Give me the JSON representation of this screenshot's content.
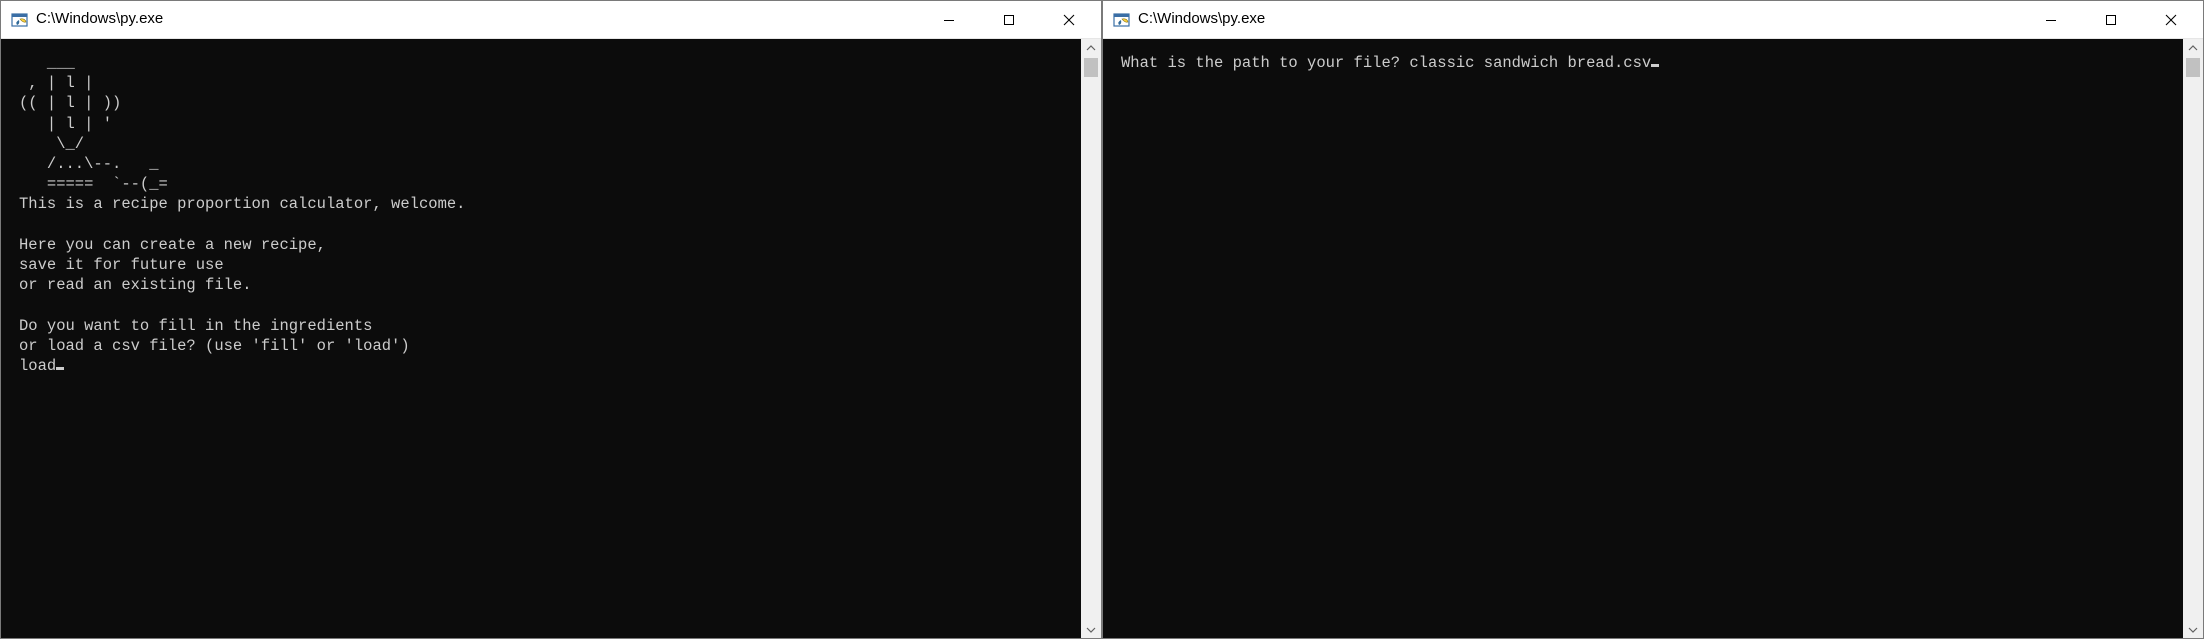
{
  "left_window": {
    "title": "C:\\Windows\\py.exe",
    "ascii_art": "   ___\n , | l |\n(( | l | ))\n   | l | '\n    \\_/\n   /...\\--.   _\n   =====  `--(_=",
    "lines": [
      "This is a recipe proportion calculator, welcome.",
      "",
      "Here you can create a new recipe,",
      "save it for future use",
      "or read an existing file.",
      "",
      "Do you want to fill in the ingredients",
      "or load a csv file? (use 'fill' or 'load')"
    ],
    "input": "load"
  },
  "right_window": {
    "title": "C:\\Windows\\py.exe",
    "prompt": "What is the path to your file? ",
    "input": "classic sandwich bread.csv"
  },
  "colors": {
    "console_bg": "#0c0c0c",
    "console_text": "#cccccc",
    "titlebar_bg": "#ffffff"
  },
  "icons": [
    "python-console-icon",
    "minimize-icon",
    "maximize-icon",
    "close-icon",
    "scroll-up-arrow-icon",
    "scroll-down-arrow-icon"
  ]
}
